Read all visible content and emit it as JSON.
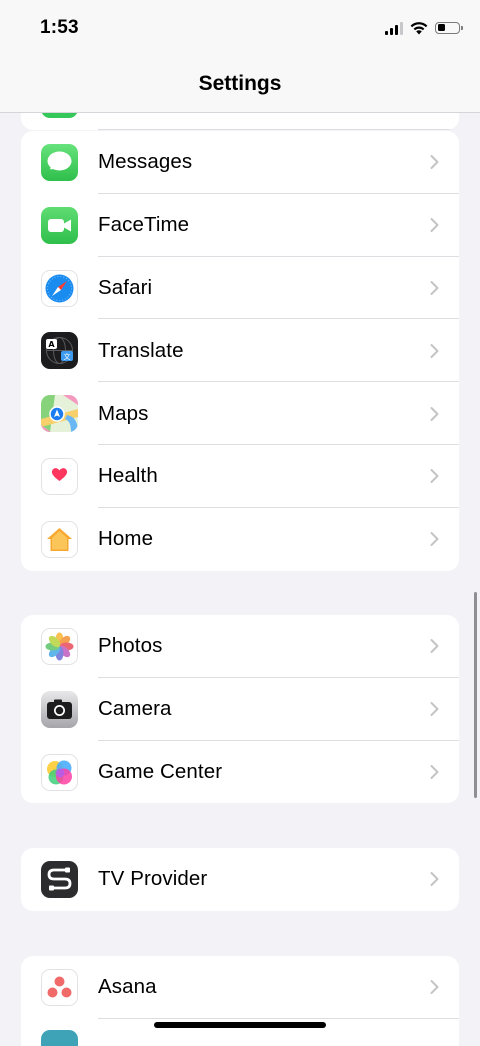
{
  "status": {
    "time": "1:53"
  },
  "nav": {
    "title": "Settings"
  },
  "groups": [
    {
      "items": [
        {
          "label": "Messages",
          "icon": "messages-icon",
          "color": "#34c759"
        },
        {
          "label": "FaceTime",
          "icon": "facetime-icon",
          "color": "#34c759"
        },
        {
          "label": "Safari",
          "icon": "safari-icon",
          "color": "#1e90ff"
        },
        {
          "label": "Translate",
          "icon": "translate-icon",
          "color": "#1c1c1e"
        },
        {
          "label": "Maps",
          "icon": "maps-icon",
          "color": "#7ed07a"
        },
        {
          "label": "Health",
          "icon": "health-icon",
          "color": "#ff375f"
        },
        {
          "label": "Home",
          "icon": "home-icon",
          "color": "#f7a831"
        }
      ]
    },
    {
      "items": [
        {
          "label": "Photos",
          "icon": "photos-icon",
          "color": "#ffffff"
        },
        {
          "label": "Camera",
          "icon": "camera-icon",
          "color": "#8e8e93"
        },
        {
          "label": "Game Center",
          "icon": "game-center-icon",
          "color": "#ffffff"
        }
      ]
    },
    {
      "items": [
        {
          "label": "TV Provider",
          "icon": "tv-provider-icon",
          "color": "#2c2c2e"
        }
      ]
    },
    {
      "items": [
        {
          "label": "Asana",
          "icon": "asana-icon",
          "color": "#f06a6a"
        }
      ]
    }
  ]
}
